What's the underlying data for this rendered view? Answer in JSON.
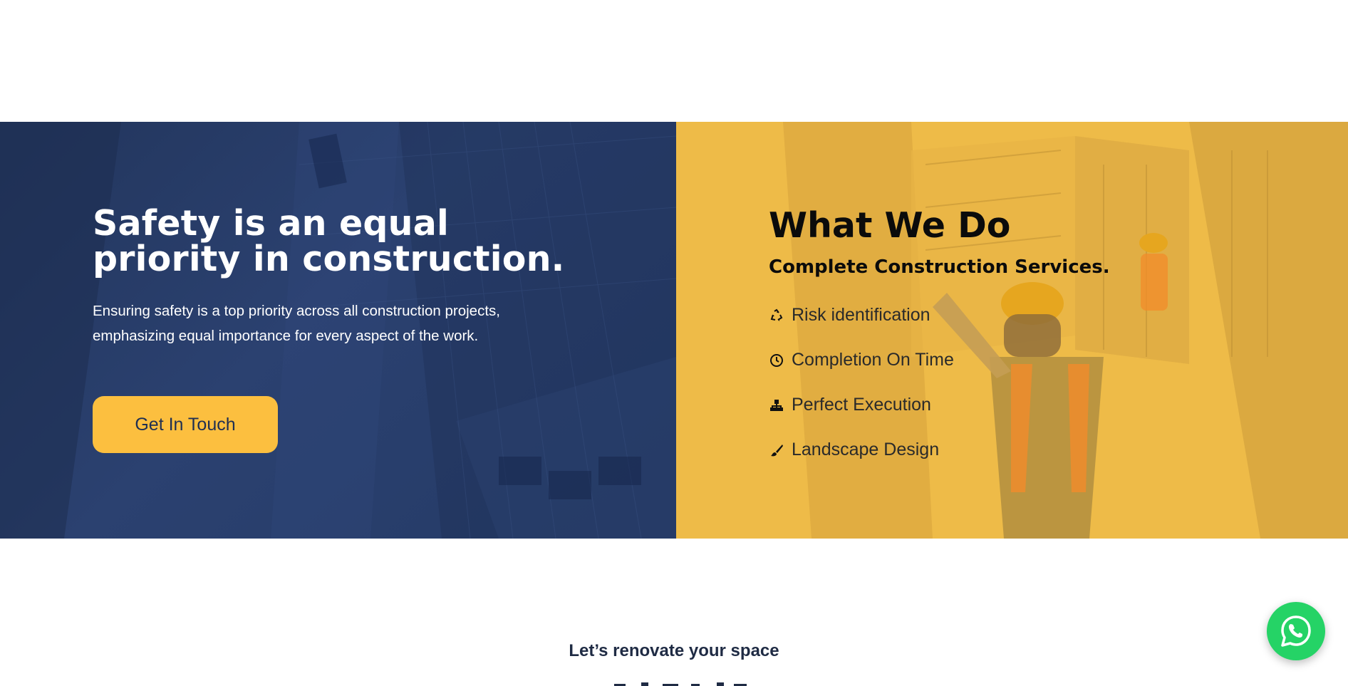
{
  "colors": {
    "navy": "#22355c",
    "gold": "#fcbf3f",
    "gold_panel": "#f0bd4a",
    "whatsapp_green": "#25d366"
  },
  "safety": {
    "title": "Safety is an equal priority in construction.",
    "description": "Ensuring safety is a top priority across all construction projects, emphasizing equal importance for every aspect of the work.",
    "cta_label": "Get In Touch"
  },
  "services": {
    "title": "What We Do",
    "subtitle": "Complete Construction Services.",
    "items": [
      {
        "label": "Risk identification",
        "icon": "recycle-icon"
      },
      {
        "label": "Completion On Time",
        "icon": "clock-icon"
      },
      {
        "label": "Perfect Execution",
        "icon": "sitemap-icon"
      },
      {
        "label": "Landscape Design",
        "icon": "paint-brush-icon"
      }
    ]
  },
  "bottom": {
    "tagline": "Let’s renovate your space"
  },
  "floating": {
    "whatsapp_icon": "whatsapp-icon"
  }
}
